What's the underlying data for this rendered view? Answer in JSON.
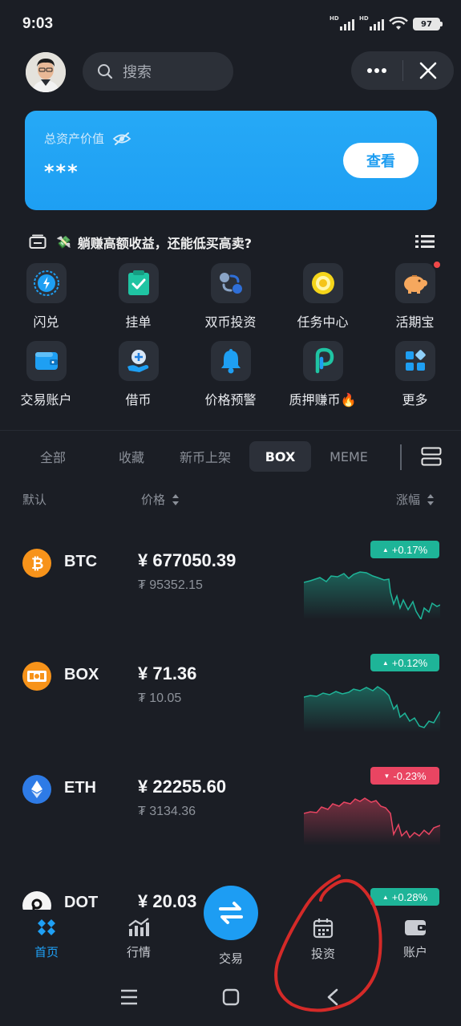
{
  "status_bar": {
    "time": "9:03",
    "signal_1": "HD",
    "signal_2": "HD",
    "battery": "97"
  },
  "header": {
    "search_placeholder": "搜索"
  },
  "asset_card": {
    "label": "总资产价值",
    "value": "***",
    "view_button": "查看"
  },
  "promo": {
    "emoji": "💸",
    "text": "躺赚高额收益，还能低买高卖?"
  },
  "quick_actions": [
    {
      "label": "闪兑",
      "icon": "flash-swap-icon"
    },
    {
      "label": "挂单",
      "icon": "clipboard-check-icon"
    },
    {
      "label": "双币投资",
      "icon": "dual-currency-icon"
    },
    {
      "label": "任务中心",
      "icon": "task-center-icon"
    },
    {
      "label": "活期宝",
      "icon": "piggy-bank-icon"
    },
    {
      "label": "交易账户",
      "icon": "wallet-icon"
    },
    {
      "label": "借币",
      "icon": "borrow-icon"
    },
    {
      "label": "价格预警",
      "icon": "bell-icon"
    },
    {
      "label": "质押赚币🔥",
      "icon": "staking-icon"
    },
    {
      "label": "更多",
      "icon": "more-grid-icon"
    }
  ],
  "market_tabs": [
    "全部",
    "收藏",
    "新币上架",
    "BOX",
    "MEME"
  ],
  "active_tab": "BOX",
  "columns": {
    "default": "默认",
    "price": "价格",
    "change": "涨幅"
  },
  "coins": [
    {
      "symbol": "BTC",
      "price": "¥ 677050.39",
      "usd": "₮ 95352.15",
      "change": "+0.17%",
      "direction": "up"
    },
    {
      "symbol": "BOX",
      "price": "¥ 71.36",
      "usd": "₮ 10.05",
      "change": "+0.12%",
      "direction": "up"
    },
    {
      "symbol": "ETH",
      "price": "¥ 22255.60",
      "usd": "₮ 3134.36",
      "change": "-0.23%",
      "direction": "down"
    },
    {
      "symbol": "DOT",
      "price": "¥ 20.03",
      "usd": "",
      "change": "+0.28%",
      "direction": "up"
    }
  ],
  "bottom_nav": {
    "home": "首页",
    "market": "行情",
    "trade": "交易",
    "invest": "投资",
    "account": "账户"
  },
  "colors": {
    "accent": "#1fa0f5",
    "up": "#1eb498",
    "down": "#e94562",
    "annotation": "#d42a28"
  }
}
